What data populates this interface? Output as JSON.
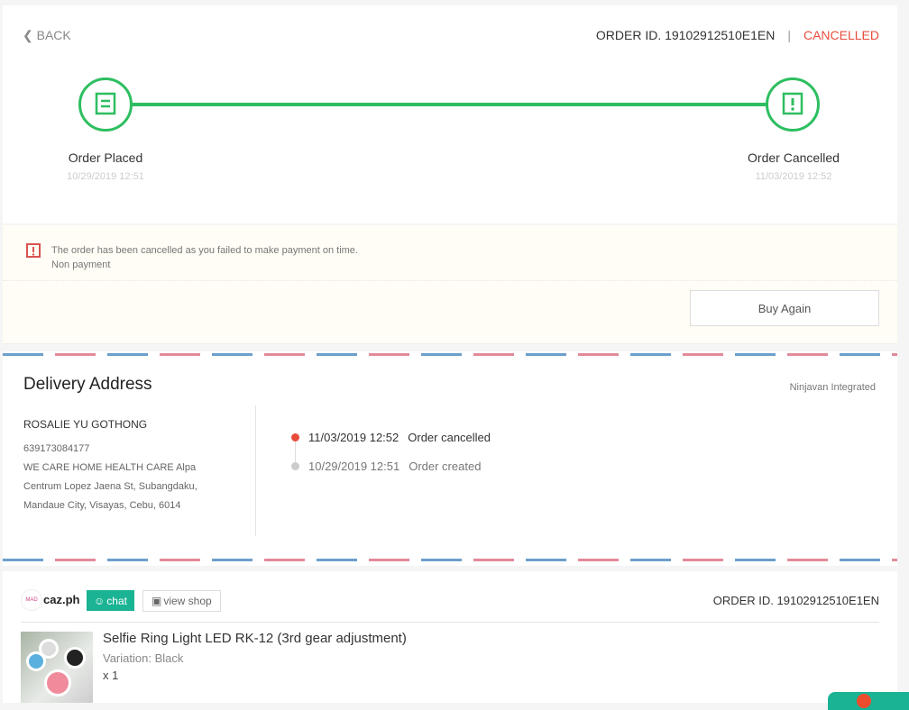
{
  "header": {
    "back_label": "BACK",
    "order_id": "ORDER ID. 19102912510E1EN",
    "status": "CANCELLED"
  },
  "progress": [
    {
      "label": "Order Placed",
      "time": "10/29/2019 12:51",
      "icon": "receipt-icon"
    },
    {
      "label": "Order Cancelled",
      "time": "11/03/2019 12:52",
      "icon": "receipt-alert-icon"
    }
  ],
  "notice": {
    "message": "The order has been cancelled as you failed to make payment on time.",
    "reason": "Non payment",
    "buy_again": "Buy Again"
  },
  "delivery": {
    "title": "Delivery Address",
    "carrier": "Ninjavan Integrated",
    "name": "ROSALIE YU GOTHONG",
    "phone": "639173084177",
    "address": "WE CARE HOME HEALTH CARE Alpa Centrum Lopez Jaena St, Subangdaku, Mandaue City, Visayas, Cebu, 6014",
    "events": [
      {
        "time": "11/03/2019 12:52",
        "text": "Order cancelled"
      },
      {
        "time": "10/29/2019 12:51",
        "text": "Order created"
      }
    ]
  },
  "shop": {
    "name": "caz.ph",
    "chat": "chat",
    "view_shop": "view shop",
    "order_id": "ORDER ID. 19102912510E1EN"
  },
  "product": {
    "name": "Selfie Ring Light LED RK-12 (3rd gear adjustment)",
    "variation": "Variation: Black",
    "qty": "x 1"
  },
  "colors": {
    "green": "#2dbe60",
    "red": "#e74c3c",
    "teal": "#1ab394"
  }
}
